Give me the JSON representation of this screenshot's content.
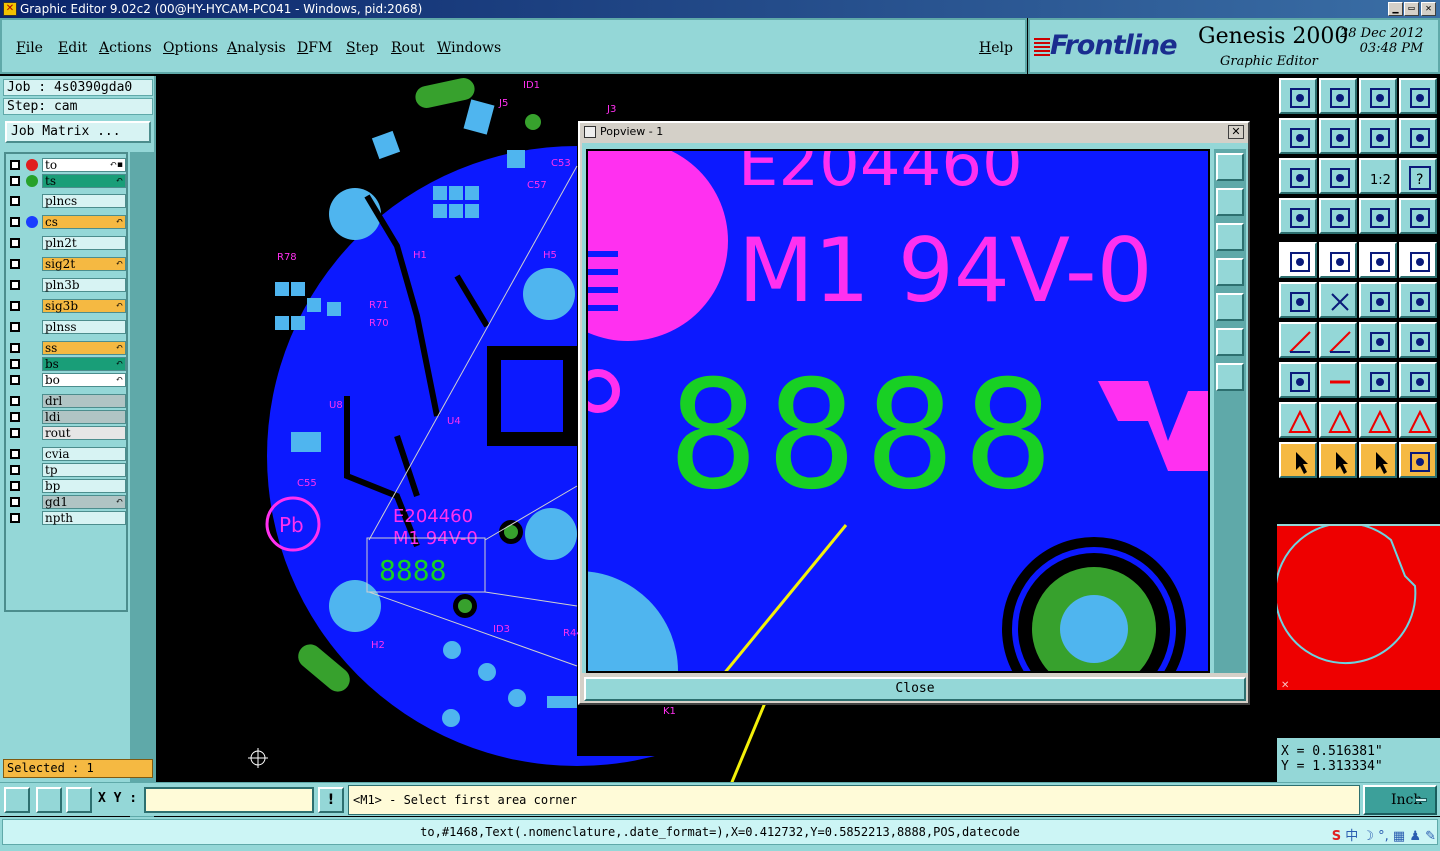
{
  "window": {
    "title": "Graphic Editor 9.02c2 (00@HY-HYCAM-PC041 - Windows, pid:2068)",
    "min_glyph": "▁",
    "max_glyph": "▭",
    "close_glyph": "✕"
  },
  "menu": {
    "items": [
      "File",
      "Edit",
      "Actions",
      "Options",
      "Analysis",
      "DFM",
      "Step",
      "Rout",
      "Windows"
    ],
    "help": "Help"
  },
  "brand": {
    "logo": "Frontline",
    "product": "Genesis 2000",
    "subtitle": "Graphic Editor",
    "date": "28 Dec 2012",
    "time": "03:48 PM"
  },
  "job": {
    "job_line": "Job : 4s0390gda0",
    "step_line": "Step: cam",
    "matrix_button": "Job Matrix ..."
  },
  "layers": [
    {
      "name": "to",
      "color": "#ffffff",
      "dot": "#e01f1f",
      "mark": "↶▪"
    },
    {
      "name": "ts",
      "color": "#199e78",
      "dot": "#27a12a",
      "mark": "↶"
    },
    {
      "name": "plncs",
      "color": "#d7f3f3",
      "dot": "",
      "mark": ""
    },
    {
      "name": "cs",
      "color": "#f5b942",
      "dot": "#1a3cff",
      "mark": "↶"
    },
    {
      "name": "pln2t",
      "color": "#d7f3f3",
      "dot": "",
      "mark": ""
    },
    {
      "name": "sig2t",
      "color": "#f5b942",
      "dot": "",
      "mark": "↶"
    },
    {
      "name": "pln3b",
      "color": "#d7f3f3",
      "dot": "",
      "mark": ""
    },
    {
      "name": "sig3b",
      "color": "#f5b942",
      "dot": "",
      "mark": "↶"
    },
    {
      "name": "plnss",
      "color": "#d7f3f3",
      "dot": "",
      "mark": ""
    },
    {
      "name": "ss",
      "color": "#f5b942",
      "dot": "",
      "mark": "↶"
    },
    {
      "name": "bs",
      "color": "#199e78",
      "dot": "",
      "mark": "↶"
    },
    {
      "name": "bo",
      "color": "#ffffff",
      "dot": "",
      "mark": "↶"
    },
    {
      "name": "drl",
      "color": "#b0c4c4",
      "dot": "",
      "mark": ""
    },
    {
      "name": "ldi",
      "color": "#b0c4c4",
      "dot": "",
      "mark": ""
    },
    {
      "name": "rout",
      "color": "#e6e6e6",
      "dot": "",
      "mark": ""
    },
    {
      "name": "cvia",
      "color": "#d7f3f3",
      "dot": "",
      "mark": ""
    },
    {
      "name": "tp",
      "color": "#d7f3f3",
      "dot": "",
      "mark": ""
    },
    {
      "name": "bp",
      "color": "#d7f3f3",
      "dot": "",
      "mark": ""
    },
    {
      "name": "gd1",
      "color": "#b0c4c4",
      "dot": "",
      "mark": "↶"
    },
    {
      "name": "npth",
      "color": "#d7f3f3",
      "dot": "",
      "mark": ""
    }
  ],
  "selected": "Selected : 1",
  "canvas": {
    "refdes": [
      "ID1",
      "J5",
      "J3",
      "C53",
      "C57",
      "R78",
      "R71",
      "R70",
      "H1",
      "H5",
      "U8",
      "U4",
      "C55",
      "H2",
      "ID3",
      "R44",
      "K1"
    ],
    "marking_code": "E204460",
    "marking_rating": "M1 94V-0",
    "marking_digits": "8888",
    "pb_label": "Pb"
  },
  "popview": {
    "title": "Popview - 1",
    "close_glyph": "✕",
    "close_label": "Close",
    "big_code": "E204460",
    "big_rating": "M1 94V-0",
    "big_digits": "8888"
  },
  "toolbar_labels": {
    "ratio": "1:2",
    "query": "?"
  },
  "coords": {
    "x": "X = 0.516381\"",
    "y": "Y = 1.313334\""
  },
  "bottom": {
    "xy_label": "X Y :",
    "xy_value": "",
    "warn_glyph": "!",
    "prompt": "<M1> - Select first area corner",
    "unit": "Inch"
  },
  "status": "to,#1468,Text(.nomenclature,.date_format=),X=0.412732,Y=0.5852213,8888,POS,datecode",
  "tray": "中 ☽ °, ▦ ♟ ✎"
}
